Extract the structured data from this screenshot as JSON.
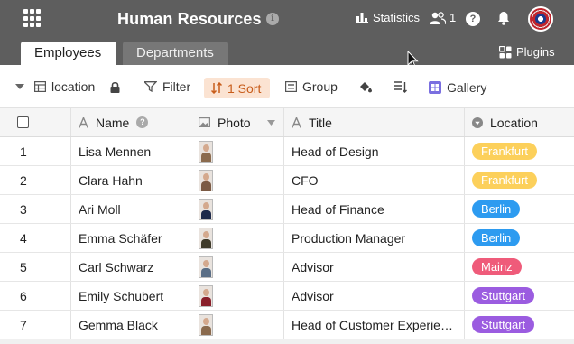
{
  "header": {
    "app_title": "Human Resources",
    "statistics_label": "Statistics",
    "collaborators_count": "1",
    "tabs": [
      {
        "label": "Employees",
        "active": true
      },
      {
        "label": "Departments",
        "active": false
      }
    ],
    "plugins_label": "Plugins",
    "background_color": "#5e5e5e"
  },
  "toolbar": {
    "view_name": "location",
    "filter_label": "Filter",
    "sort_label": "1 Sort",
    "group_label": "Group",
    "gallery_label": "Gallery",
    "sort_color": "#c85c1a"
  },
  "table": {
    "columns": [
      {
        "label": "Name",
        "icon": "text-icon"
      },
      {
        "label": "Photo",
        "icon": "image-icon"
      },
      {
        "label": "Title",
        "icon": "text-icon"
      },
      {
        "label": "Location",
        "icon": "single-select-icon"
      }
    ],
    "rows": [
      {
        "index": "1",
        "name": "Lisa Mennen",
        "title": "Head of Design",
        "location": "Frankfurt",
        "location_color": "#fcd05b",
        "photo_color": "#8b6b4e"
      },
      {
        "index": "2",
        "name": "Clara Hahn",
        "title": "CFO",
        "location": "Frankfurt",
        "location_color": "#fcd05b",
        "photo_color": "#7b5a44"
      },
      {
        "index": "3",
        "name": "Ari Moll",
        "title": "Head of Finance",
        "location": "Berlin",
        "location_color": "#2d9bf0",
        "photo_color": "#1d2a4a"
      },
      {
        "index": "4",
        "name": "Emma Schäfer",
        "title": "Production Manager",
        "location": "Berlin",
        "location_color": "#2d9bf0",
        "photo_color": "#3e3a2a"
      },
      {
        "index": "5",
        "name": "Carl Schwarz",
        "title": "Advisor",
        "location": "Mainz",
        "location_color": "#ef5b7a",
        "photo_color": "#5a6e86"
      },
      {
        "index": "6",
        "name": "Emily Schubert",
        "title": "Advisor",
        "location": "Stuttgart",
        "location_color": "#9b5ce0",
        "photo_color": "#8a1f2a"
      },
      {
        "index": "7",
        "name": "Gemma Black",
        "title": "Head of Customer Experience",
        "location": "Stuttgart",
        "location_color": "#9b5ce0",
        "photo_color": "#8b6b4e"
      }
    ]
  }
}
